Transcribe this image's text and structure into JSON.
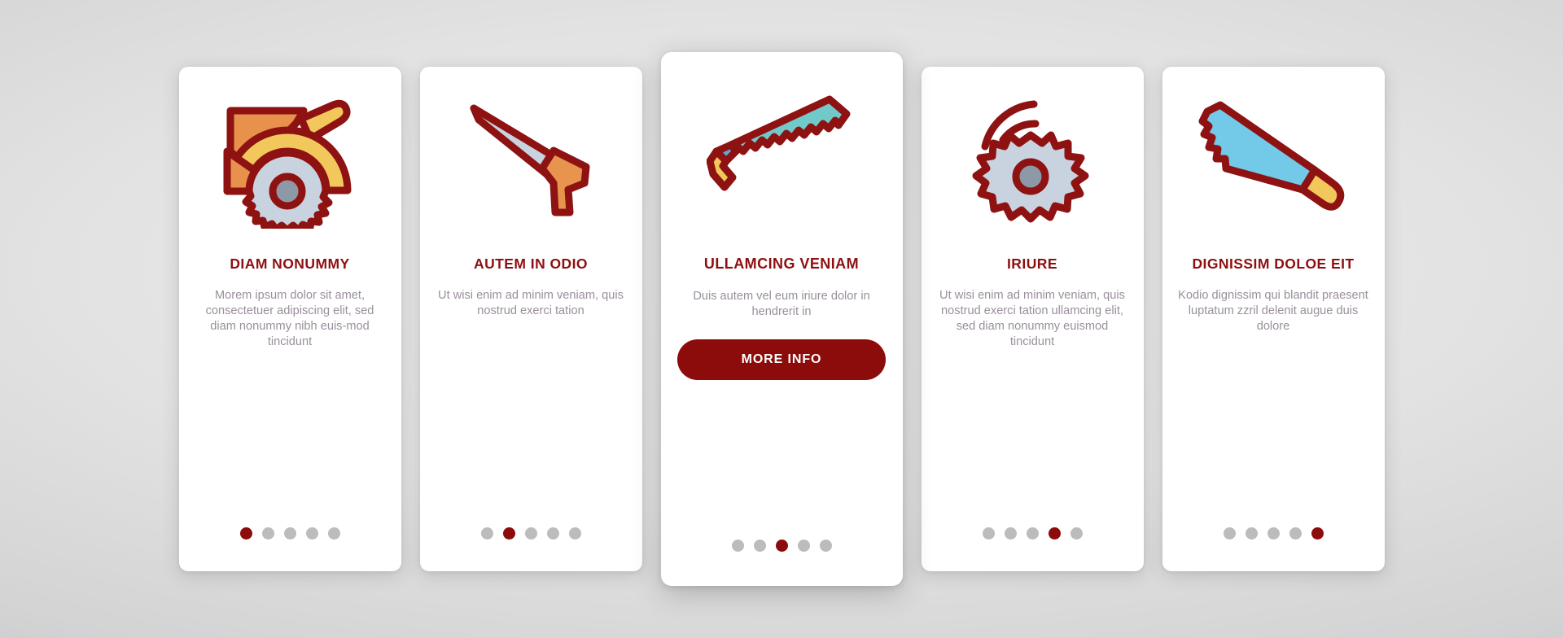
{
  "theme": {
    "accent": "#8C0B0B",
    "title_color": "#8E0F11",
    "body_color": "#9A8F9C",
    "dot_inactive": "#BCBCBC",
    "card_bg": "#FFFFFF",
    "page_bg": "#D6D6D7"
  },
  "cards": [
    {
      "icon": "circular-saw-icon",
      "title": "DIAM NONUMMY",
      "body": "Morem ipsum dolor sit amet, consectetuer adipiscing elit, sed diam nonummy nibh euis-mod tincidunt",
      "dots": {
        "count": 5,
        "active_index": 0
      },
      "featured": false
    },
    {
      "icon": "hand-saw-icon",
      "title": "AUTEM IN ODIO",
      "body": "Ut wisi enim ad minim veniam, quis nostrud exerci tation",
      "dots": {
        "count": 5,
        "active_index": 1
      },
      "featured": false
    },
    {
      "icon": "pull-saw-icon",
      "title": "ULLAMCING VENIAM",
      "body": "Duis autem vel eum iriure dolor in hendrerit in",
      "cta_label": "MORE INFO",
      "dots": {
        "count": 5,
        "active_index": 2
      },
      "featured": true
    },
    {
      "icon": "saw-blade-icon",
      "title": "IRIURE",
      "body": "Ut wisi enim ad minim veniam, quis nostrud exerci tation ullamcing elit, sed diam nonummy euismod tincidunt",
      "dots": {
        "count": 5,
        "active_index": 3
      },
      "featured": false
    },
    {
      "icon": "blue-handsaw-icon",
      "title": "DIGNISSIM DOLOE EIT",
      "body": "Kodio dignissim qui blandit praesent luptatum zzril delenit augue duis dolore",
      "dots": {
        "count": 5,
        "active_index": 4
      },
      "featured": false
    }
  ]
}
